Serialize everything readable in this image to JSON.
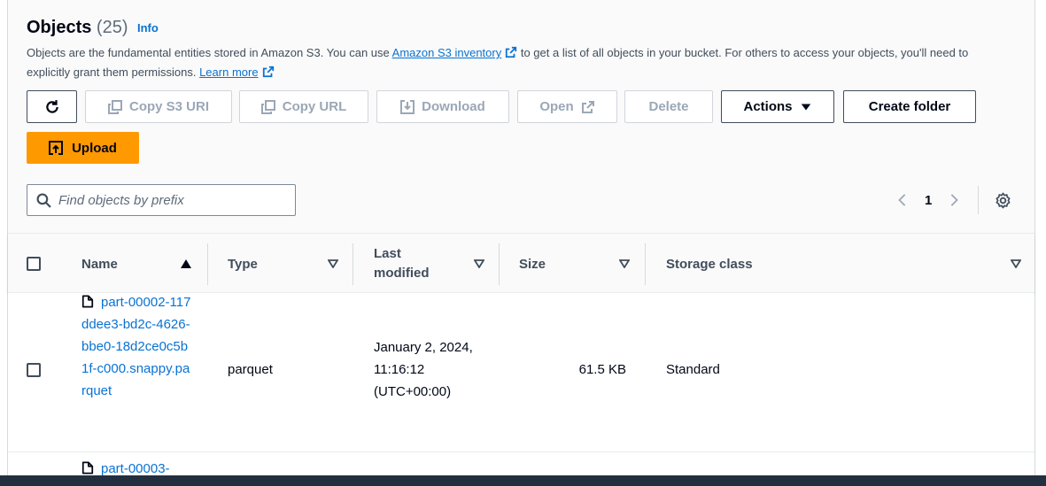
{
  "header": {
    "title": "Objects",
    "count": "(25)",
    "info_label": "Info",
    "desc_part1": "Objects are the fundamental entities stored in Amazon S3. You can use ",
    "inventory_link": "Amazon S3 inventory",
    "desc_part2": " to get a list of all objects in your bucket. For others to access your objects, you'll need to explicitly grant them permissions. ",
    "learn_more": "Learn more"
  },
  "toolbar": {
    "copy_s3_uri": "Copy S3 URI",
    "copy_url": "Copy URL",
    "download": "Download",
    "open": "Open",
    "delete": "Delete",
    "actions": "Actions",
    "create_folder": "Create folder",
    "upload": "Upload"
  },
  "search": {
    "placeholder": "Find objects by prefix"
  },
  "pagination": {
    "current_page": "1"
  },
  "table": {
    "columns": {
      "name": "Name",
      "type": "Type",
      "last_modified": "Last modified",
      "size": "Size",
      "storage_class": "Storage class"
    },
    "rows": [
      {
        "name": "part-00002-117ddee3-bd2c-4626-bbe0-18d2ce0c5b1f-c000.snappy.parquet",
        "type": "parquet",
        "last_modified": "January 2, 2024, 11:16:12 (UTC+00:00)",
        "size": "61.5 KB",
        "storage_class": "Standard"
      },
      {
        "name": "part-00003-"
      }
    ]
  },
  "colors": {
    "accent": "#0972d3",
    "upload_button": "#ff9900",
    "disabled_text": "#9ba7b6"
  },
  "icons": [
    "refresh-icon",
    "copy-icon",
    "download-icon",
    "external-link-icon",
    "caret-down-icon",
    "upload-icon",
    "search-icon",
    "chevron-left-icon",
    "chevron-right-icon",
    "settings-gear-icon",
    "file-icon",
    "sort-ascending-icon",
    "sort-descending-icon"
  ]
}
